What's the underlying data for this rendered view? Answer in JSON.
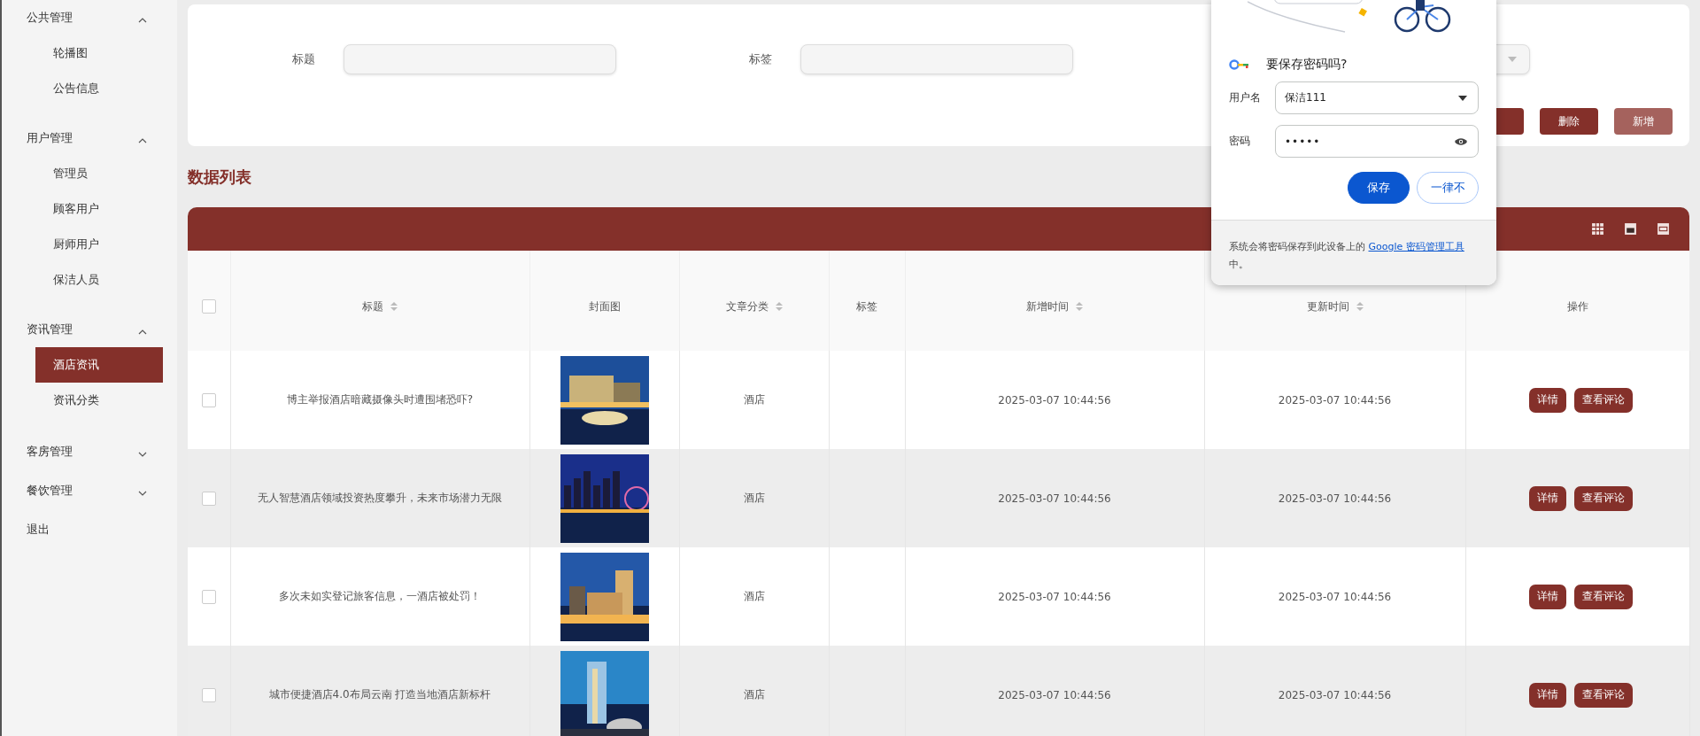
{
  "sidebar": {
    "groups": [
      {
        "label": "公共管理",
        "expanded": true,
        "items": [
          {
            "label": "轮播图",
            "selected": false
          },
          {
            "label": "公告信息",
            "selected": false
          }
        ]
      },
      {
        "label": "用户管理",
        "expanded": true,
        "items": [
          {
            "label": "管理员",
            "selected": false
          },
          {
            "label": "顾客用户",
            "selected": false
          },
          {
            "label": "厨师用户",
            "selected": false
          },
          {
            "label": "保洁人员",
            "selected": false
          }
        ]
      },
      {
        "label": "资讯管理",
        "expanded": true,
        "items": [
          {
            "label": "酒店资讯",
            "selected": true
          },
          {
            "label": "资讯分类",
            "selected": false
          }
        ]
      },
      {
        "label": "客房管理",
        "expanded": false
      },
      {
        "label": "餐饮管理",
        "expanded": false
      }
    ],
    "logout": "退出"
  },
  "search_form": {
    "fields": [
      {
        "label": "标题"
      },
      {
        "label": "标签"
      }
    ],
    "buttons": [
      {
        "label": "删除",
        "hovered": false
      },
      {
        "label": "新增",
        "hovered": true
      }
    ]
  },
  "table": {
    "title": "数据列表",
    "select_all_checked": false,
    "columns": [
      {
        "label": "标题",
        "sortable": true
      },
      {
        "label": "封面图",
        "sortable": false
      },
      {
        "label": "文章分类",
        "sortable": true
      },
      {
        "label": "标签",
        "sortable": false
      },
      {
        "label": "新增时间",
        "sortable": true
      },
      {
        "label": "更新时间",
        "sortable": true
      },
      {
        "label": "操作",
        "sortable": false
      }
    ],
    "rows": [
      {
        "checked": false,
        "title": "博主举报酒店暗藏摄像头时遭围堵恐吓?",
        "category": "酒店",
        "created": "2025-03-07 10:44:56",
        "updated": "2025-03-07 10:44:56",
        "actions": [
          "详情",
          "查看评论"
        ]
      },
      {
        "checked": false,
        "title": "无人智慧酒店领域投资热度攀升，未来市场潜力无限",
        "category": "酒店",
        "created": "2025-03-07 10:44:56",
        "updated": "2025-03-07 10:44:56",
        "actions": [
          "详情",
          "查看评论"
        ]
      },
      {
        "checked": false,
        "title": "多次未如实登记旅客信息，一酒店被处罚！",
        "category": "酒店",
        "created": "2025-03-07 10:44:56",
        "updated": "2025-03-07 10:44:56",
        "actions": [
          "详情",
          "查看评论"
        ]
      },
      {
        "checked": false,
        "title": "城市便捷酒店4.0布局云南 打造当地酒店新标杆",
        "category": "酒店",
        "created": "2025-03-07 10:44:56",
        "updated": "2025-03-07 10:44:56",
        "actions": [
          "详情",
          "查看评论"
        ]
      }
    ]
  },
  "password_popup": {
    "title": "要保存密码吗?",
    "username_label": "用户名",
    "username": "保洁111",
    "password_label": "密码",
    "password": "•••••",
    "buttons": [
      {
        "label": "保存",
        "kind": "primary"
      },
      {
        "label": "一律不",
        "kind": "secondary"
      }
    ],
    "footer_text": "系统会将密码保存到此设备上的",
    "footer_link": "Google 密码管理工具",
    "footer_end": "中。"
  }
}
